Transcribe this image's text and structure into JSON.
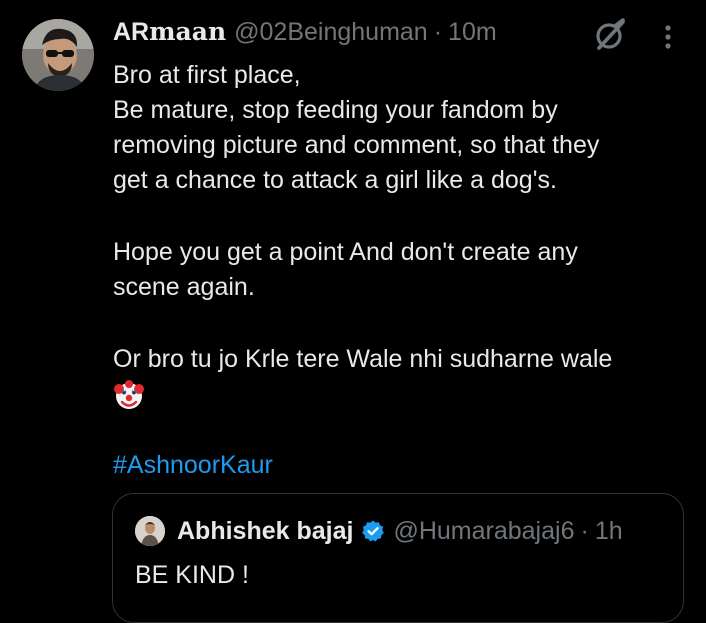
{
  "tweet": {
    "author": {
      "name_plain": "AR",
      "name_fancy": "maan",
      "handle": "@02Beinghuman",
      "separator": "·",
      "time": "10m"
    },
    "lines": [
      "Bro at first place,",
      "Be mature, stop feeding your fandom by",
      "removing picture and comment, so that they",
      "get a chance to attack a girl like a dog's.",
      "Hope you get a point And don't create any",
      "scene again.",
      "Or bro tu jo Krle tere Wale nhi sudharne wale"
    ],
    "emoji": "clown-face",
    "hashtag": "#AshnoorKaur"
  },
  "quoted": {
    "name": "Abhishek bajaj",
    "handle": "@Humarabajaj6",
    "separator": "·",
    "time": "1h",
    "text": "BE KIND !",
    "verified_color": "#1d9bf0"
  },
  "icons": {
    "grok": "grok-icon",
    "more": "more-dots-icon",
    "verified": "verified-badge-icon"
  },
  "colors": {
    "background": "#000000",
    "text": "#e7e9ea",
    "muted": "#71767b",
    "link": "#1d9bf0",
    "border": "#2f3336"
  }
}
